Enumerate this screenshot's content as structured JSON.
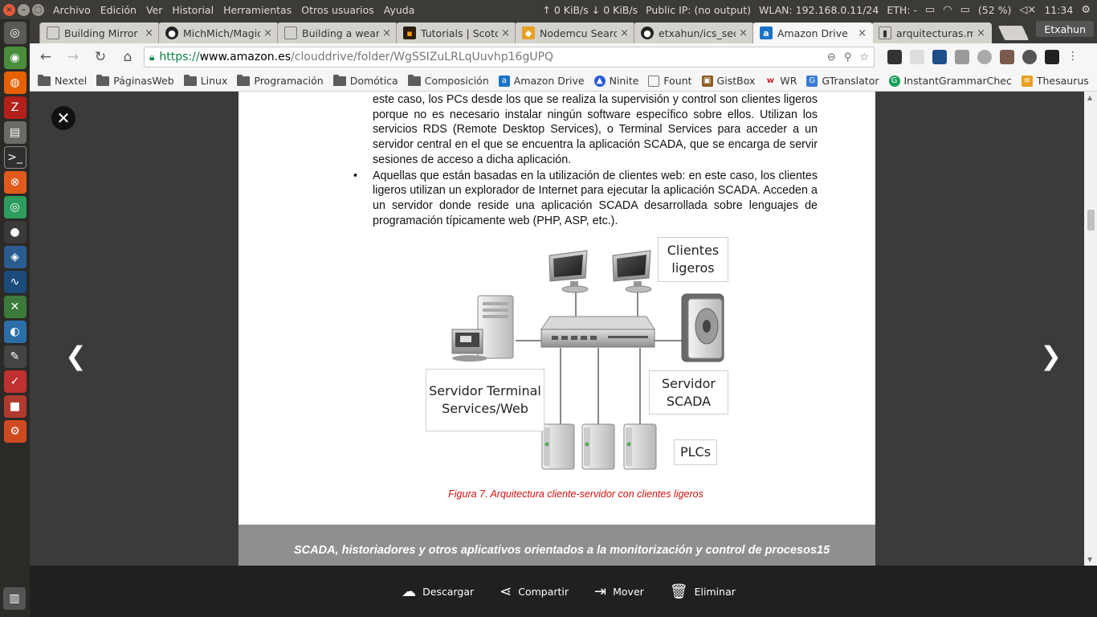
{
  "top_panel": {
    "menu": [
      "Archivo",
      "Edición",
      "Ver",
      "Historial",
      "Herramientas",
      "Otros usuarios",
      "Ayuda"
    ],
    "net_speed": "↑ 0 KiB/s ↓ 0 KiB/s",
    "public_ip": "Public IP: (no output)",
    "wlan": "WLAN: 192.168.0.11/24",
    "eth": "ETH: -",
    "battery": "(52 %)",
    "clock": "11:34"
  },
  "tabs": [
    {
      "title": "Building Mirror Me",
      "icon": "page-icon"
    },
    {
      "title": "MichMich/Magic",
      "icon": "github-icon"
    },
    {
      "title": "Building a weara",
      "icon": "page-icon"
    },
    {
      "title": "Tutorials | Scotch",
      "icon": "scotch-icon"
    },
    {
      "title": "Nodemcu Search",
      "icon": "nodemcu-icon"
    },
    {
      "title": "etxahun/ics_sec",
      "icon": "github-icon"
    },
    {
      "title": "Amazon Drive",
      "icon": "amazon-icon",
      "active": true
    },
    {
      "title": "arquitecturas.md",
      "icon": "book-icon"
    }
  ],
  "profile_name": "Etxahun",
  "address": {
    "scheme": "https://",
    "host": "www.amazon.es",
    "path": "/clouddrive/folder/WgSSIZuLRLqUuvhp16gUPQ"
  },
  "bookmarks": [
    {
      "label": "Nextel",
      "type": "folder"
    },
    {
      "label": "PáginasWeb",
      "type": "folder"
    },
    {
      "label": "Linux",
      "type": "folder"
    },
    {
      "label": "Programación",
      "type": "folder"
    },
    {
      "label": "Domótica",
      "type": "folder"
    },
    {
      "label": "Composición",
      "type": "folder"
    },
    {
      "label": "Amazon Drive",
      "type": "amazon"
    },
    {
      "label": "Ninite",
      "type": "ninite"
    },
    {
      "label": "Fount",
      "type": "page"
    },
    {
      "label": "GistBox",
      "type": "gistbox"
    },
    {
      "label": "WR",
      "type": "wr"
    },
    {
      "label": "GTranslator",
      "type": "gtranslator"
    },
    {
      "label": "InstantGrammarChec",
      "type": "grammar"
    },
    {
      "label": "Thesaurus",
      "type": "thesaurus"
    }
  ],
  "document": {
    "para1": "este caso, los PCs desde los que se realiza la supervisión y control son clientes ligeros porque no es necesario instalar ningún software específico sobre ellos. Utilizan los servicios RDS (Remote Desktop Services), o Terminal Services para acceder a un servidor central en el que se encuentra la aplicación SCADA, que se encarga de servir sesiones de acceso a dicha aplicación.",
    "bullet2": "Aquellas que están basadas en la utilización de clientes web: en este caso, los clientes ligeros utilizan un explorador de Internet para ejecutar la aplicación SCADA. Acceden a un servidor donde reside una aplicación SCADA desarrollada sobre lenguajes de programación típicamente web (PHP, ASP, etc.).",
    "figure_labels": {
      "clients": "Clientes ligeros",
      "terminal_server": "Servidor Terminal Services/Web",
      "scada_server": "Servidor SCADA",
      "plcs": "PLCs"
    },
    "caption": "Figura 7. Arquitectura cliente-servidor con clientes ligeros",
    "footer": "SCADA, historiadores y otros aplicativos orientados a la monitorización y control de procesos15"
  },
  "actions": {
    "download": "Descargar",
    "share": "Compartir",
    "move": "Mover",
    "delete": "Eliminar"
  }
}
